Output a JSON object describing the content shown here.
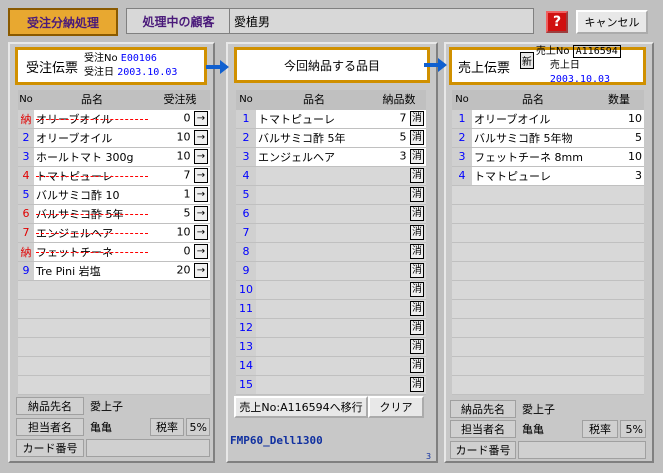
{
  "header": {
    "title": "受注分納処理",
    "customer_label": "処理中の顧客",
    "customer_name": "愛植男",
    "help_label": "?",
    "cancel_label": "キャンセル"
  },
  "left": {
    "box_title": "受注伝票",
    "order_no_label": "受注No",
    "order_no": "E00106",
    "order_date_label": "受注日",
    "order_date": "2003.10.03",
    "col_no": "No",
    "col_name": "品名",
    "col_qty": "受注残",
    "rows": [
      {
        "no": "納",
        "name": "オリーブオイル",
        "qty": "0",
        "done": true
      },
      {
        "no": "2",
        "name": "オリーブオイル",
        "qty": "10",
        "done": false
      },
      {
        "no": "3",
        "name": "ホールトマト 300g",
        "qty": "10",
        "done": false
      },
      {
        "no": "4",
        "name": "トマトピューレ",
        "qty": "7",
        "done": true
      },
      {
        "no": "5",
        "name": "バルサミコ酢 10",
        "qty": "1",
        "done": false
      },
      {
        "no": "6",
        "name": "バルサミコ酢 5年",
        "qty": "5",
        "done": true
      },
      {
        "no": "7",
        "name": "エンジェルヘア",
        "qty": "10",
        "done": true
      },
      {
        "no": "納",
        "name": "フェットチーネ",
        "qty": "0",
        "done": true
      },
      {
        "no": "9",
        "name": "Tre Pini  岩塩",
        "qty": "20",
        "done": false
      }
    ],
    "ship_to_label": "納品先名",
    "ship_to": "愛上子",
    "staff_label": "担当者名",
    "staff": "亀亀",
    "tax_label": "税率",
    "tax": "5%",
    "card_label": "カード番号",
    "card": ""
  },
  "mid": {
    "box_title": "今回納品する品目",
    "col_no": "No",
    "col_name": "品名",
    "col_qty": "納品数",
    "rows": [
      {
        "no": "1",
        "name": "トマトピューレ",
        "qty": "7"
      },
      {
        "no": "2",
        "name": "バルサミコ酢 5年",
        "qty": "5"
      },
      {
        "no": "3",
        "name": "エンジェルヘア",
        "qty": "3"
      },
      {
        "no": "4",
        "name": "",
        "qty": ""
      },
      {
        "no": "5",
        "name": "",
        "qty": ""
      },
      {
        "no": "6",
        "name": "",
        "qty": ""
      },
      {
        "no": "7",
        "name": "",
        "qty": ""
      },
      {
        "no": "8",
        "name": "",
        "qty": ""
      },
      {
        "no": "9",
        "name": "",
        "qty": ""
      },
      {
        "no": "10",
        "name": "",
        "qty": ""
      },
      {
        "no": "11",
        "name": "",
        "qty": ""
      },
      {
        "no": "12",
        "name": "",
        "qty": ""
      },
      {
        "no": "13",
        "name": "",
        "qty": ""
      },
      {
        "no": "14",
        "name": "",
        "qty": ""
      },
      {
        "no": "15",
        "name": "",
        "qty": ""
      }
    ],
    "delete_label": "消",
    "transfer_label": "売上No:A116594へ移行",
    "clear_label": "クリア",
    "footer_id": "FMP60_Dell1300",
    "footer_num": "3"
  },
  "right": {
    "box_title": "売上伝票",
    "new_label": "新",
    "sale_no_label": "売上No",
    "sale_no": "A116594",
    "sale_date_label": "売上日",
    "sale_date": "2003.10.03",
    "col_no": "No",
    "col_name": "品名",
    "col_qty": "数量",
    "rows": [
      {
        "no": "1",
        "name": "オリーブオイル",
        "qty": "10"
      },
      {
        "no": "2",
        "name": "バルサミコ酢 5年物",
        "qty": "5"
      },
      {
        "no": "3",
        "name": "フェットチーネ 8mm",
        "qty": "10"
      },
      {
        "no": "4",
        "name": "トマトピューレ",
        "qty": "3"
      }
    ],
    "ship_to_label": "納品先名",
    "ship_to": "愛上子",
    "staff_label": "担当者名",
    "staff": "亀亀",
    "tax_label": "税率",
    "tax": "5%",
    "card_label": "カード番号",
    "card": ""
  },
  "colors": {
    "accent": "#e8a830",
    "arrow": "#1060d0",
    "help_red": "#d01010",
    "number_blue": "#0000ff"
  }
}
